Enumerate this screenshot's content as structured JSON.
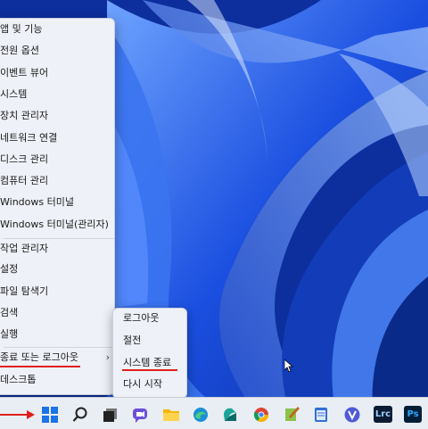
{
  "context_menu": {
    "items": [
      {
        "label": "앱 및 기능",
        "has_submenu": false
      },
      {
        "label": "전원 옵션",
        "has_submenu": false
      },
      {
        "label": "이벤트 뷰어",
        "has_submenu": false
      },
      {
        "label": "시스템",
        "has_submenu": false
      },
      {
        "label": "장치 관리자",
        "has_submenu": false
      },
      {
        "label": "네트워크 연결",
        "has_submenu": false
      },
      {
        "label": "디스크 관리",
        "has_submenu": false
      },
      {
        "label": "컴퓨터 관리",
        "has_submenu": false
      },
      {
        "label": "Windows 터미널",
        "has_submenu": false
      },
      {
        "label": "Windows 터미널(관리자)",
        "has_submenu": false
      },
      {
        "label": "작업 관리자",
        "has_submenu": false
      },
      {
        "label": "설정",
        "has_submenu": false
      },
      {
        "label": "파일 탐색기",
        "has_submenu": false
      },
      {
        "label": "검색",
        "has_submenu": false
      },
      {
        "label": "실행",
        "has_submenu": false
      },
      {
        "label": "종료 또는 로그아웃",
        "has_submenu": true
      },
      {
        "label": "데스크톱",
        "has_submenu": false
      }
    ],
    "submenu_chevron": "›"
  },
  "shutdown_submenu": {
    "items": [
      {
        "label": "로그아웃"
      },
      {
        "label": "절전"
      },
      {
        "label": "시스템 종료"
      },
      {
        "label": "다시 시작"
      }
    ]
  },
  "taskbar": {
    "icons": [
      {
        "name": "start-icon",
        "color": "#1a73e8"
      },
      {
        "name": "search-icon",
        "color": "#222222"
      },
      {
        "name": "task-view-icon",
        "color": "#222222"
      },
      {
        "name": "chat-icon",
        "color": "#6b4fd8"
      },
      {
        "name": "file-explorer-icon",
        "color": "#f2b800"
      },
      {
        "name": "edge-icon",
        "color": "#1b8fd6"
      },
      {
        "name": "app-icon",
        "color": "#18a59b"
      },
      {
        "name": "chrome-icon",
        "color": "#db4437"
      },
      {
        "name": "notepad-plus-icon",
        "color": "#8bc34a"
      },
      {
        "name": "notepad-icon",
        "color": "#2f6fd6"
      },
      {
        "name": "v-app-icon",
        "color": "#4f5bd5"
      },
      {
        "name": "lightroom-icon",
        "color": "#0a1b33",
        "text": "Lrc"
      },
      {
        "name": "photoshop-icon",
        "color": "#001e36",
        "text": "Ps"
      }
    ]
  },
  "colors": {
    "annotation_red": "#e0201b",
    "menu_bg": "#eef1f8",
    "taskbar_bg": "#e9edf4"
  }
}
